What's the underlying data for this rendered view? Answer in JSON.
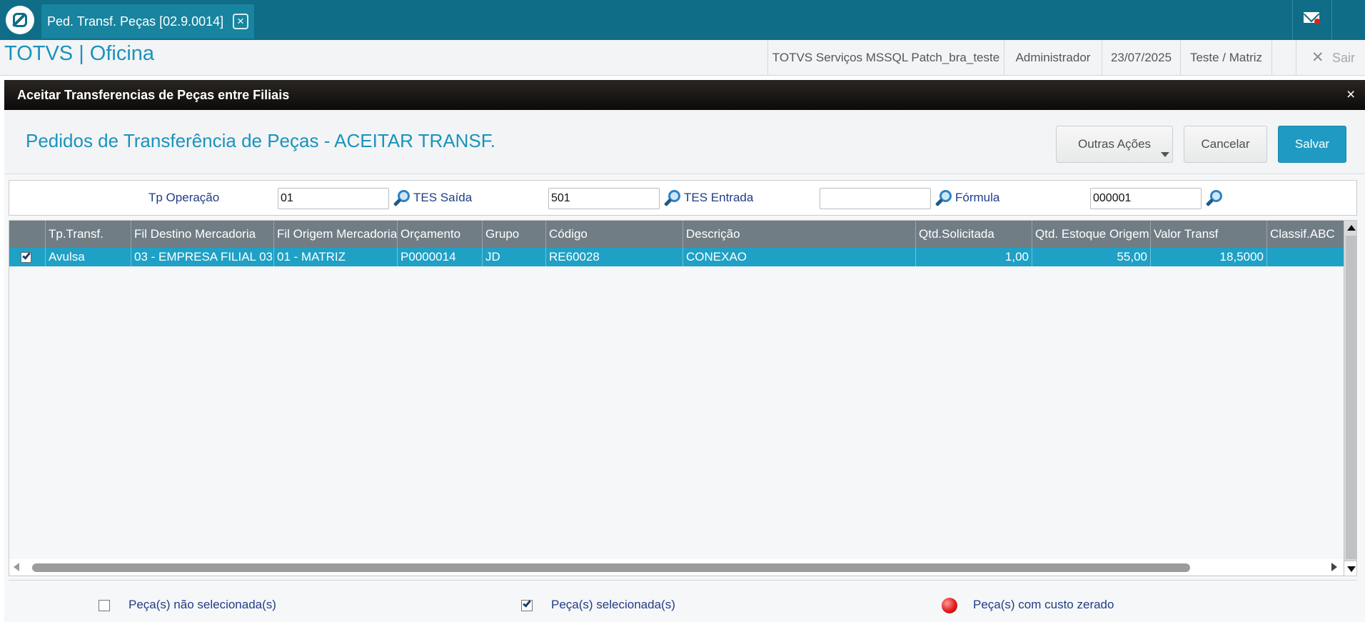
{
  "tab": {
    "title": "Ped. Transf. Peças [02.9.0014]",
    "close_icon": "×"
  },
  "header": {
    "app_title": "TOTVS | Oficina",
    "environment": "TOTVS Serviços MSSQL Patch_bra_teste",
    "user": "Administrador",
    "date": "23/07/2025",
    "branch": "Teste / Matriz",
    "exit_label": "Sair",
    "exit_icon": "✕"
  },
  "dialog": {
    "title": "Aceitar Transferencias de Peças entre Filiais",
    "close_icon": "×",
    "page_title": "Pedidos de Transferência de Peças - ACEITAR TRANSF.",
    "buttons": {
      "other_actions": "Outras Ações",
      "cancel": "Cancelar",
      "save": "Salvar"
    }
  },
  "filters": {
    "op_type_label": "Tp Operação",
    "op_type_value": "01",
    "tes_out_label": "TES Saída",
    "tes_out_value": "501",
    "tes_in_label": "TES Entrada",
    "tes_in_value": "",
    "formula_label": "Fórmula",
    "formula_value": "000001"
  },
  "grid": {
    "columns": [
      "Tp.Transf.",
      "Fil Destino Mercadoria",
      "Fil Origem Mercadoria",
      "Orçamento",
      "Grupo",
      "Código",
      "Descrição",
      "Qtd.Solicitada",
      "Qtd. Estoque Origem",
      "Valor Transf",
      "Classif.ABC"
    ],
    "rows": [
      {
        "selected": true,
        "cells": [
          "Avulsa",
          "03 - EMPRESA FILIAL 03",
          "01 - MATRIZ",
          "P0000014",
          "JD",
          "RE60028",
          "CONEXAO",
          "1,00",
          "55,00",
          "18,5000",
          ""
        ]
      }
    ]
  },
  "legend": {
    "not_selected": "Peça(s) não selecionada(s)",
    "selected": "Peça(s) selecionada(s)",
    "zero_cost": "Peça(s) com custo zerado"
  },
  "colors": {
    "topbar": "#0f6d87",
    "accent": "#1a93bd",
    "grid_header": "#717d84",
    "selected_row": "#1fa0c5",
    "save_button": "#1f9bc3"
  }
}
